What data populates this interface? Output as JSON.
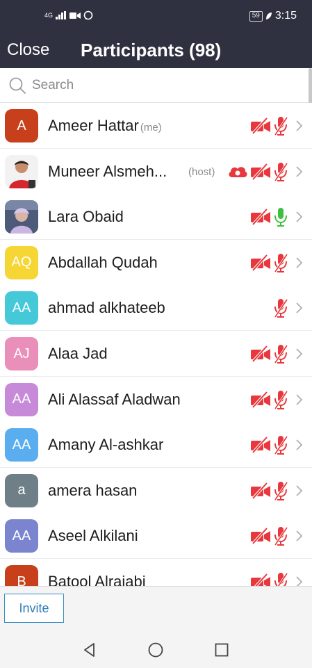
{
  "status_bar": {
    "network": "4G",
    "battery": "59",
    "time": "3:15"
  },
  "header": {
    "close_label": "Close",
    "title": "Participants (98)"
  },
  "search": {
    "placeholder": "Search",
    "value": ""
  },
  "participants": [
    {
      "initials": "A",
      "name": "Ameer Hattar",
      "tag": "(me)",
      "avatar_color": "#c7401b",
      "video_muted": true,
      "mic": "muted",
      "host": false,
      "cloud": false
    },
    {
      "initials": "",
      "name": "Muneer Alsmeh...",
      "tag": "(host)",
      "avatar_color": "#e9e9e9",
      "photo": "man-photo",
      "video_muted": true,
      "mic": "muted",
      "host": true,
      "cloud": true
    },
    {
      "initials": "",
      "name": "Lara Obaid",
      "tag": "",
      "avatar_color": "#6c7b9a",
      "photo": "woman-photo",
      "video_muted": true,
      "mic": "active",
      "host": false,
      "cloud": false
    },
    {
      "initials": "AQ",
      "name": "Abdallah Qudah",
      "tag": "",
      "avatar_color": "#f5d634",
      "video_muted": true,
      "mic": "muted",
      "host": false,
      "cloud": false
    },
    {
      "initials": "AA",
      "name": "ahmad alkhateeb",
      "tag": "",
      "avatar_color": "#45c9d9",
      "video_muted": false,
      "mic": "muted",
      "host": false,
      "cloud": false
    },
    {
      "initials": "AJ",
      "name": "Alaa Jad",
      "tag": "",
      "avatar_color": "#ea8fb9",
      "video_muted": true,
      "mic": "muted",
      "host": false,
      "cloud": false
    },
    {
      "initials": "AA",
      "name": "Ali Alassaf Aladwan",
      "tag": "",
      "avatar_color": "#c78ad9",
      "video_muted": true,
      "mic": "muted",
      "host": false,
      "cloud": false
    },
    {
      "initials": "AA",
      "name": "Amany Al-ashkar",
      "tag": "",
      "avatar_color": "#5aaef0",
      "video_muted": true,
      "mic": "muted",
      "host": false,
      "cloud": false
    },
    {
      "initials": "a",
      "name": "amera hasan",
      "tag": "",
      "avatar_color": "#6f7f87",
      "video_muted": true,
      "mic": "muted",
      "host": false,
      "cloud": false
    },
    {
      "initials": "AA",
      "name": "Aseel Alkilani",
      "tag": "",
      "avatar_color": "#7b84cf",
      "video_muted": true,
      "mic": "muted",
      "host": false,
      "cloud": false
    },
    {
      "initials": "B",
      "name": "Batool Alrajabi",
      "tag": "",
      "avatar_color": "#c7401b",
      "video_muted": true,
      "mic": "muted",
      "host": false,
      "cloud": false
    }
  ],
  "footer": {
    "invite_label": "Invite"
  },
  "nav": {
    "back": "back-icon",
    "home": "home-icon",
    "recents": "recents-icon"
  },
  "colors": {
    "header_bg": "#2f3040",
    "muted_red": "#e8383d",
    "mic_green": "#3fbf3f",
    "accent_blue": "#2d8cc0"
  }
}
